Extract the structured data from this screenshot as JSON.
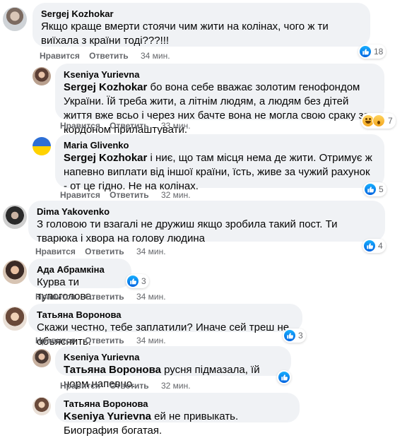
{
  "comments": [
    {
      "author": "Sergej Kozhokar",
      "text": "Якщо краще вмерти стоячи чим жити на колінах, чого ж ти виїхала з країни тоді???!!!",
      "actions": {
        "like": "Нравится",
        "reply": "Ответить",
        "time": "34 мин."
      },
      "reactions": {
        "count": "18",
        "types": [
          "like-icon"
        ]
      }
    },
    {
      "author": "Kseniya Yurievna",
      "mention": "Sergej Kozhokar",
      "text": " бо вона себе вважає золотим генофондом України. Їй треба жити, а літнім людям, а людям без дітей життя вже всьо і через них бачте вона не могла свою сраку за кордоном прилаштувати.",
      "actions": {
        "like": "Нравится",
        "reply": "Ответить",
        "time": "33 мин."
      },
      "reactions": {
        "count": "7",
        "types": [
          "haha-icon",
          "wow-icon"
        ]
      }
    },
    {
      "author": "Maria Glivenko",
      "mention": "Sergej Kozhokar",
      "text": " і ниє, що там місця нема де жити. Отримує ж напевно виплати від іншої країни, їсть, живе за чужий рахунок - от це гідно. Не на колінах.",
      "actions": {
        "like": "Нравится",
        "reply": "Ответить",
        "time": "32 мин."
      },
      "reactions": {
        "count": "5",
        "types": [
          "like-icon"
        ]
      }
    },
    {
      "author": "Dima Yakovenko",
      "text": "З головою ти взагалі не дружиш якщо зробила такий пост. Ти тварюка і хвора на голову людина",
      "actions": {
        "like": "Нравится",
        "reply": "Ответить",
        "time": "34 мин."
      },
      "reactions": {
        "count": "4",
        "types": [
          "like-icon"
        ]
      }
    },
    {
      "author": "Ада Абрамкіна",
      "text": "Курва ти тупоголова.",
      "actions": {
        "like": "Нравится",
        "reply": "Ответить",
        "time": "34 мин."
      },
      "reactions": {
        "count": "3",
        "types": [
          "like-icon"
        ]
      }
    },
    {
      "author": "Татьяна Воронова",
      "text": "Скажи честно, тебе заплатили? Иначе сей треш не объяснить.",
      "actions": {
        "like": "Нравится",
        "reply": "Ответить",
        "time": "34 мин."
      },
      "reactions": {
        "count": "3",
        "types": [
          "like-icon"
        ]
      }
    },
    {
      "author": "Kseniya Yurievna",
      "mention": "Татьяна Воронова",
      "text": " русня підмазала, їй норм напевно.",
      "actions": {
        "like": "Нравится",
        "reply": "Ответить",
        "time": "32 мин."
      },
      "reactions": {
        "count": "",
        "types": [
          "like-icon"
        ]
      }
    },
    {
      "author": "Татьяна Воронова",
      "mention": "Kseniya Yurievna",
      "text": " ей не привыкать. Биография богатая."
    }
  ],
  "colors": {
    "bubble": "#f0f2f5",
    "meta": "#65676b",
    "like": "#0866ff"
  }
}
